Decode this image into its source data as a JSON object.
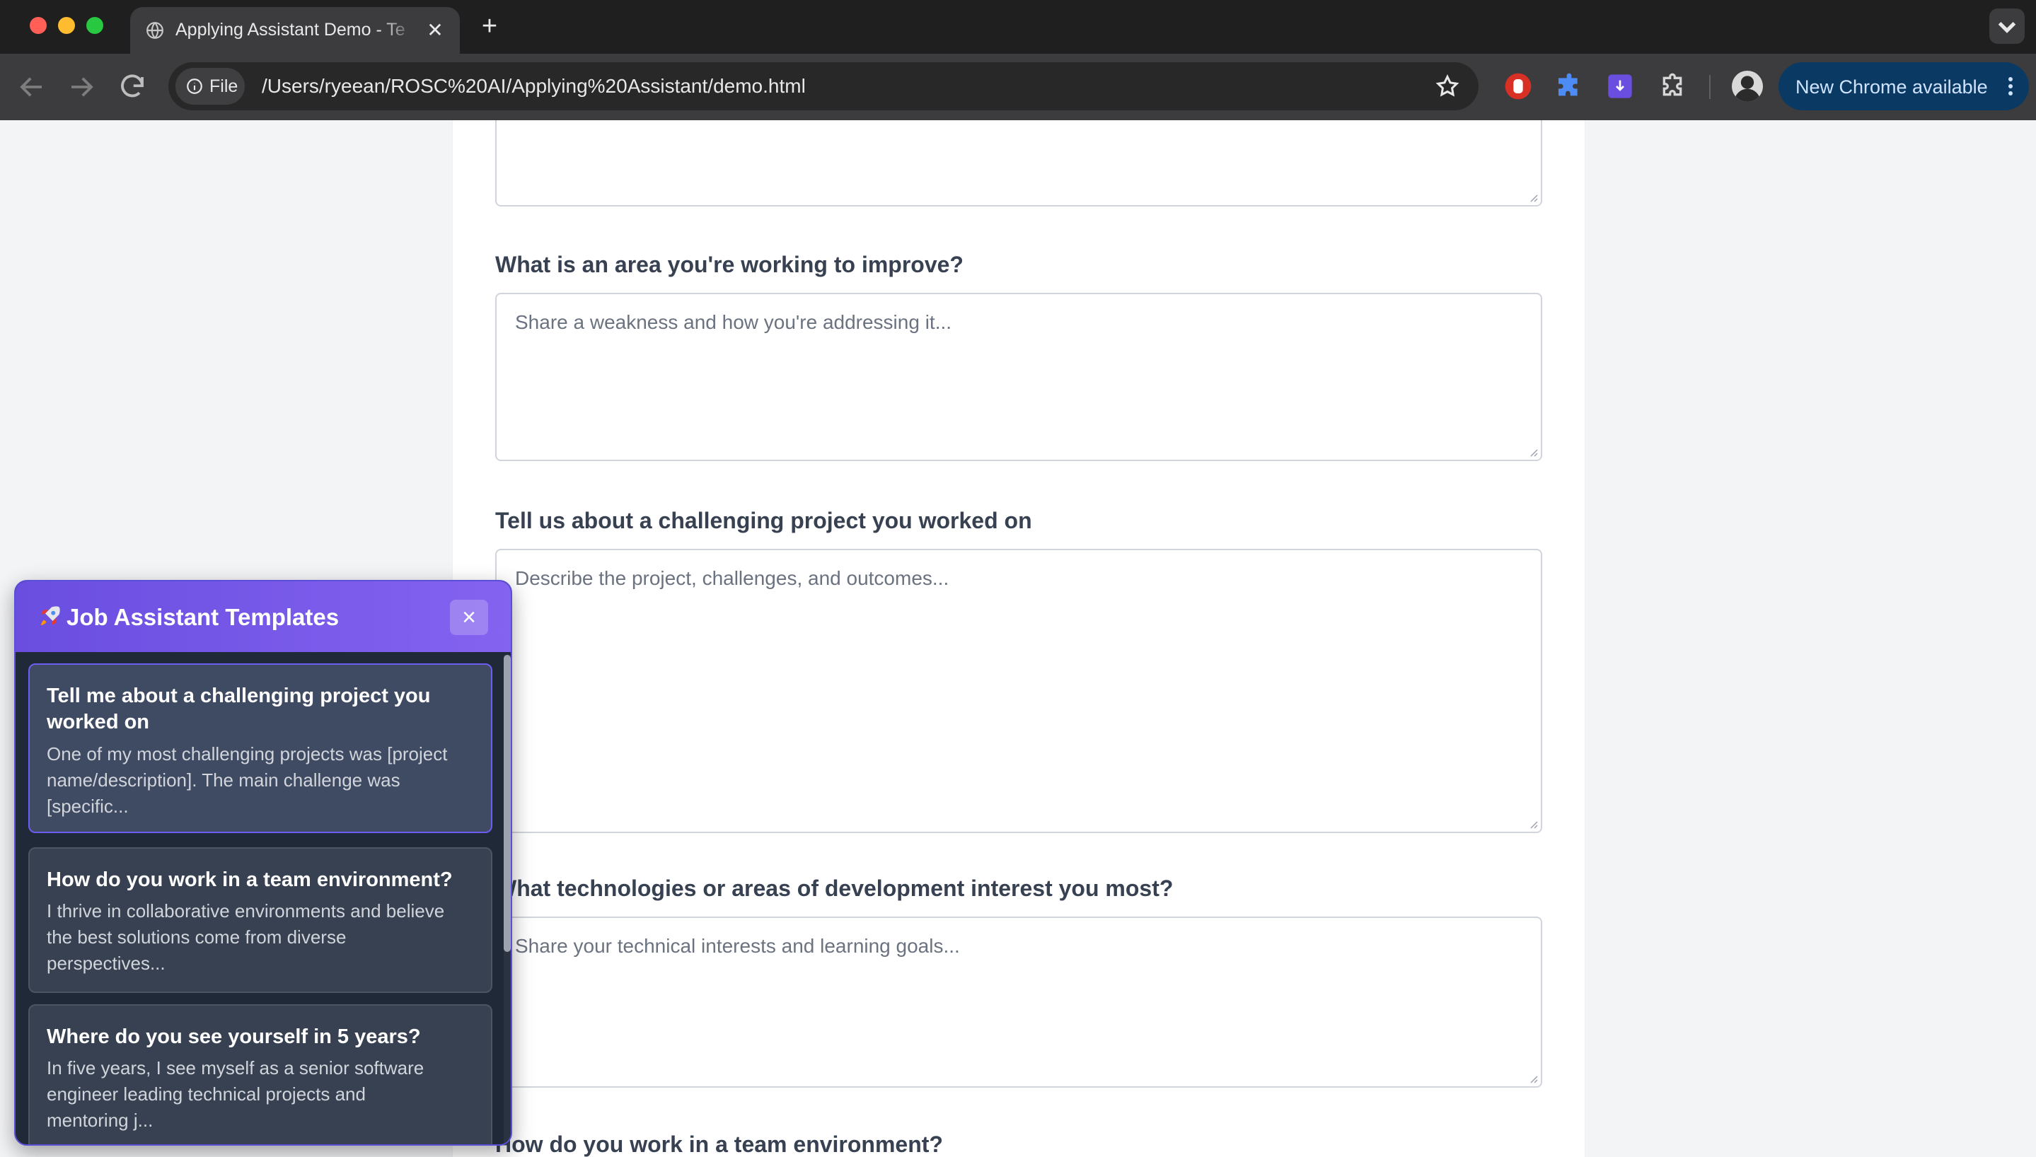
{
  "browser": {
    "tab_title": "Applying Assistant Demo - Te",
    "url_chip": "File",
    "url": "/Users/ryeean/ROSC%20AI/Applying%20Assistant/demo.html",
    "update_label": "New Chrome available",
    "icons": [
      "globe-icon",
      "close-icon",
      "plus-icon",
      "chevron-down-icon",
      "back-icon",
      "forward-icon",
      "reload-icon",
      "info-icon",
      "star-icon",
      "extension-icons",
      "avatar",
      "more-vert-icon"
    ]
  },
  "form": {
    "questions": [
      {
        "label": "What is an area you're working to improve?",
        "placeholder": "Share a weakness and how you're addressing it..."
      },
      {
        "label": "Tell us about a challenging project you worked on",
        "placeholder": "Describe the project, challenges, and outcomes..."
      },
      {
        "label": "What technologies or areas of development interest you most?",
        "placeholder": "Share your technical interests and learning goals..."
      },
      {
        "label": "How do you work in a team environment?"
      }
    ]
  },
  "panel": {
    "icon": "🚀",
    "title": "Job Assistant Templates",
    "close_label": "×",
    "templates": [
      {
        "title": "Tell me about a challenging project you worked on",
        "preview_lines": [
          "One of my most challenging projects was [project",
          "name/description]. The main challenge was",
          "[specific..."
        ]
      },
      {
        "title": "How do you work in a team environment?",
        "preview_lines": [
          "I thrive in collaborative environments and believe",
          "the best solutions come from diverse",
          "perspectives..."
        ]
      },
      {
        "title": "Where do you see yourself in 5 years?",
        "preview_lines": [
          "In five years, I see myself as a senior software",
          "engineer leading technical projects and",
          "mentoring j..."
        ]
      }
    ]
  },
  "colors": {
    "panel_header_start": "#6a4ee0",
    "panel_header_end": "#8463f0",
    "panel_bg": "#1f2937",
    "chrome_update_pill": "#0a3a64"
  }
}
